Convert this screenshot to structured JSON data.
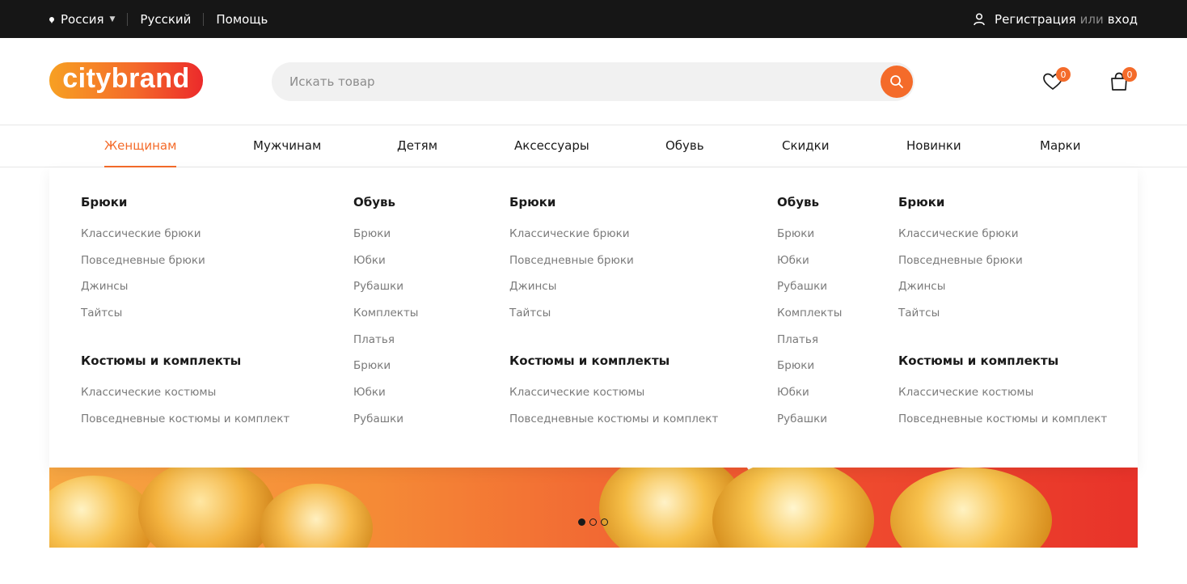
{
  "topbar": {
    "region": "Россия",
    "language": "Русский",
    "help": "Помощь",
    "register": "Регистрация",
    "or": "или",
    "login": "вход"
  },
  "header": {
    "logo": "citybrand",
    "search_placeholder": "Искать товар",
    "wishlist_count": "0",
    "cart_count": "0"
  },
  "nav": {
    "items": [
      "Женщинам",
      "Мужчинам",
      "Детям",
      "Аксессуары",
      "Обувь",
      "Скидки",
      "Новинки",
      "Марки"
    ],
    "active": "Женщинам"
  },
  "mega_menu": {
    "columns": [
      {
        "sections": [
          {
            "title": "Брюки",
            "links": [
              "Классические брюки",
              "Повседневные брюки",
              "Джинсы",
              "Тайтсы"
            ]
          },
          {
            "title": "Костюмы и комплекты",
            "links": [
              "Классические костюмы",
              "Повседневные костюмы и комплект"
            ]
          }
        ]
      },
      {
        "sections": [
          {
            "title": "Обувь",
            "links": [
              "Брюки",
              "Юбки",
              "Рубашки",
              "Комплекты",
              "Платья",
              "Брюки",
              "Юбки",
              "Рубашки"
            ]
          }
        ]
      },
      {
        "sections": [
          {
            "title": "Брюки",
            "links": [
              "Классические брюки",
              "Повседневные брюки",
              "Джинсы",
              "Тайтсы"
            ]
          },
          {
            "title": "Костюмы и комплекты",
            "links": [
              "Классические костюмы",
              "Повседневные костюмы и комплект"
            ]
          }
        ]
      },
      {
        "sections": [
          {
            "title": "Обувь",
            "links": [
              "Брюки",
              "Юбки",
              "Рубашки",
              "Комплекты",
              "Платья",
              "Брюки",
              "Юбки",
              "Рубашки"
            ]
          }
        ]
      },
      {
        "sections": [
          {
            "title": "Брюки",
            "links": [
              "Классические брюки",
              "Повседневные брюки",
              "Джинсы",
              "Тайтсы"
            ]
          },
          {
            "title": "Костюмы и комплекты",
            "links": [
              "Классические костюмы",
              "Повседневные костюмы и комплект"
            ]
          }
        ]
      }
    ]
  },
  "banner": {
    "slides": 3,
    "active_slide": 1
  },
  "colors": {
    "accent": "#f46b2a",
    "topbar_bg": "#161616"
  }
}
